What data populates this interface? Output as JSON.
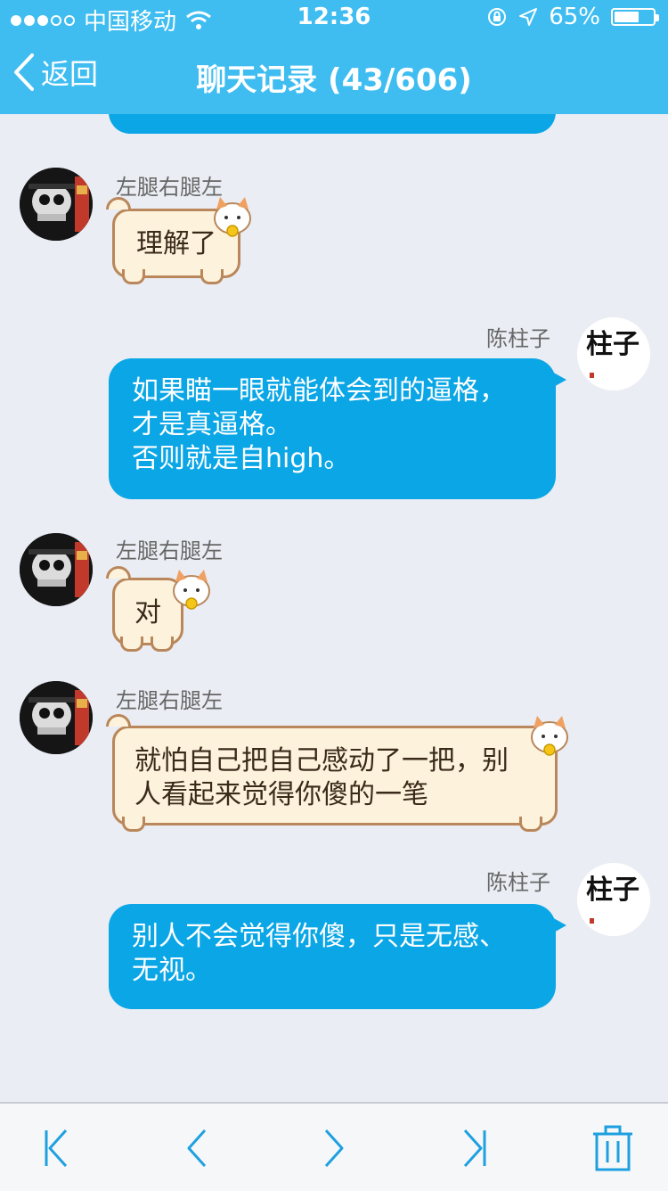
{
  "status_bar": {
    "carrier": "中国移动",
    "time": "12:36",
    "battery": "65%",
    "battery_level": 0.65
  },
  "nav": {
    "back_label": "返回",
    "title": "聊天记录 (43/606)"
  },
  "messages": [
    {
      "side": "left",
      "sender": "左腿右腿左",
      "text": "理解了"
    },
    {
      "side": "right",
      "sender": "陈柱子",
      "text": "如果瞄一眼就能体会到的逼格，\n才是真逼格。\n否则就是自high。"
    },
    {
      "side": "left",
      "sender": "左腿右腿左",
      "text": "对"
    },
    {
      "side": "left",
      "sender": "左腿右腿左",
      "text": "就怕自己把自己感动了一把，别\n人看起来觉得你傻的一笔"
    },
    {
      "side": "right",
      "sender": "陈柱子",
      "text": "别人不会觉得你傻，只是无感、\n无视。"
    }
  ],
  "avatar_right_text": "柱子",
  "toolbar": {
    "icons": [
      "first-page-icon",
      "previous-page-icon",
      "next-page-icon",
      "last-page-icon",
      "trash-icon"
    ]
  },
  "colors": {
    "nav_bg": "#3fbdf1",
    "bubble_self": "#0aa6e6",
    "bubble_other": "#fdf3dc",
    "bubble_other_border": "#b9875b",
    "toolbar_icon": "#1ea0e0"
  }
}
